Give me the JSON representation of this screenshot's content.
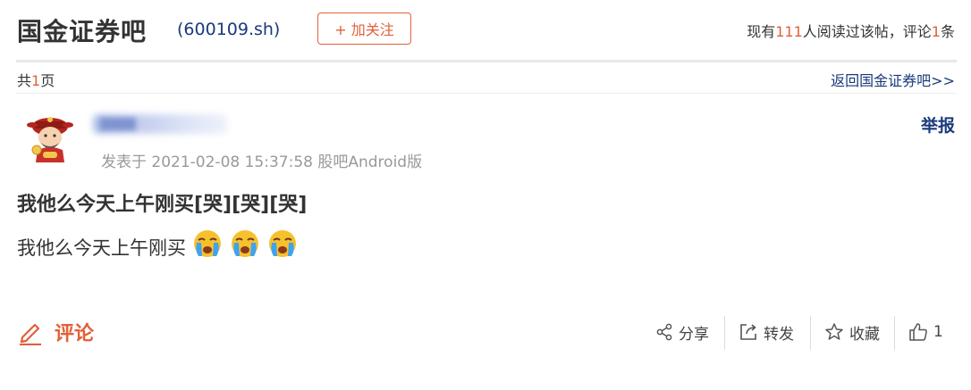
{
  "header": {
    "bar_title": "国金证券吧",
    "stock_code": "(600109.sh)",
    "follow_label": "+ 加关注",
    "stats_prefix": "现有",
    "stats_readers": "111",
    "stats_mid": "人阅读过该帖，评论",
    "stats_comments": "1",
    "stats_suffix": "条"
  },
  "pager": {
    "prefix": "共",
    "count": "1",
    "suffix": "页",
    "back_link": "返回国金证券吧>>"
  },
  "post": {
    "report_label": "举报",
    "meta": "发表于 2021-02-08 15:37:58 股吧Android版",
    "title": "我他么今天上午刚买[哭][哭][哭]",
    "body_text": "我他么今天上午刚买",
    "emojis": [
      "crying-face-emoji",
      "crying-face-emoji",
      "crying-face-emoji"
    ]
  },
  "actions": {
    "comment_label": "评论",
    "share_label": "分享",
    "forward_label": "转发",
    "favorite_label": "收藏",
    "like_count": "1"
  },
  "colors": {
    "accent": "#e2603a",
    "link": "#1a3a7a",
    "muted": "#999999"
  }
}
